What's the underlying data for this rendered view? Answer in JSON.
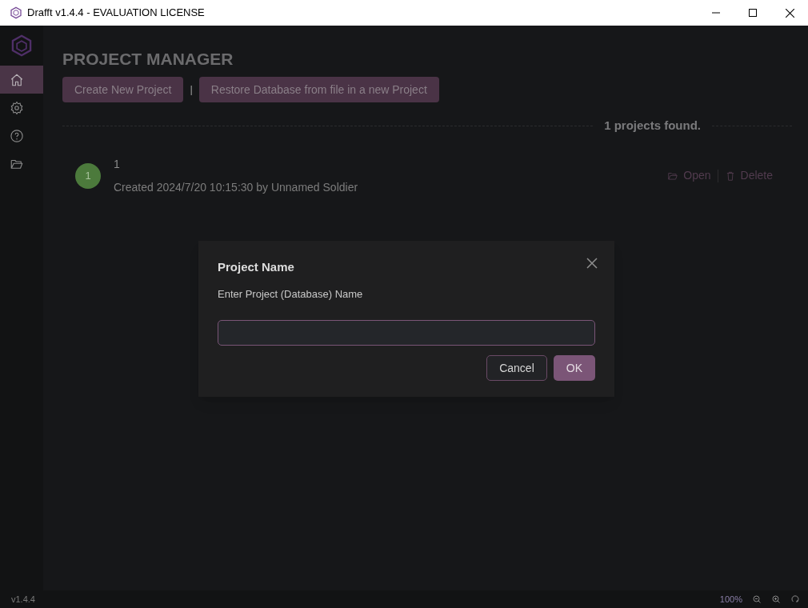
{
  "window": {
    "title": "Drafft v1.4.4 - EVALUATION LICENSE"
  },
  "sidebar": {
    "items": [
      {
        "selected": true
      },
      {
        "selected": false
      },
      {
        "selected": false
      },
      {
        "selected": false
      }
    ]
  },
  "page": {
    "title": "PROJECT MANAGER",
    "buttons": [
      "Create New Project",
      "Restore Database from file in a new Project"
    ],
    "separator": "|",
    "count": "1 projects found."
  },
  "projects": [
    {
      "avatar": "1",
      "name": "1",
      "meta": "Created 2024/7/20 10:15:30 by Unnamed Soldier",
      "actions": [
        "Open",
        "Delete"
      ]
    }
  ],
  "dialog": {
    "title": "Project Name",
    "label": "Enter Project (Database) Name",
    "buttons": [
      "Cancel",
      "OK"
    ]
  },
  "status_bar": {
    "version": "v1.4.4",
    "zoom": "100%"
  }
}
